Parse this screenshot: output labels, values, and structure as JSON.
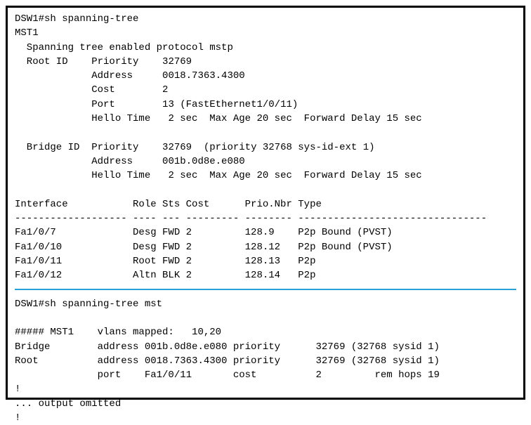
{
  "cmd1": "DSW1#sh spanning-tree",
  "inst": "MST1",
  "stp_enabled": "  Spanning tree enabled protocol mstp",
  "root": {
    "label": "  Root ID    Priority    ",
    "priority": "32769",
    "addr_label": "             Address     ",
    "addr": "0018.7363.4300",
    "cost_label": "             Cost        ",
    "cost": "2",
    "port_label": "             Port        ",
    "port": "13 (FastEthernet1/0/11)",
    "hello_label": "             Hello Time   ",
    "hello": "2 sec  Max Age 20 sec  Forward Delay 15 sec"
  },
  "bridge": {
    "label": "  Bridge ID  Priority    ",
    "priority": "32769  (priority 32768 sys-id-ext 1)",
    "addr_label": "             Address     ",
    "addr": "001b.0d8e.e080",
    "hello_label": "             Hello Time   ",
    "hello": "2 sec  Max Age 20 sec  Forward Delay 15 sec"
  },
  "table": {
    "hdr": "Interface           Role Sts Cost      Prio.Nbr Type",
    "dash": "------------------- ---- --- --------- -------- --------------------------------",
    "rows": [
      "Fa1/0/7             Desg FWD 2         128.9    P2p Bound (PVST)",
      "Fa1/0/10            Desg FWD 2         128.12   P2p Bound (PVST)",
      "Fa1/0/11            Root FWD 2         128.13   P2p",
      "Fa1/0/12            Altn BLK 2         128.14   P2p"
    ]
  },
  "cmd2": "DSW1#sh spanning-tree mst",
  "mst": {
    "head": "##### MST1    vlans mapped:   10,20",
    "bridge": "Bridge        address 001b.0d8e.e080 priority      32769 (32768 sysid 1)",
    "root": "Root          address 0018.7363.4300 priority      32769 (32768 sysid 1)",
    "port": "              port    Fa1/0/11       cost          2         rem hops 19"
  },
  "tail1": "!",
  "tail2": "... output omitted",
  "tail3": "!"
}
